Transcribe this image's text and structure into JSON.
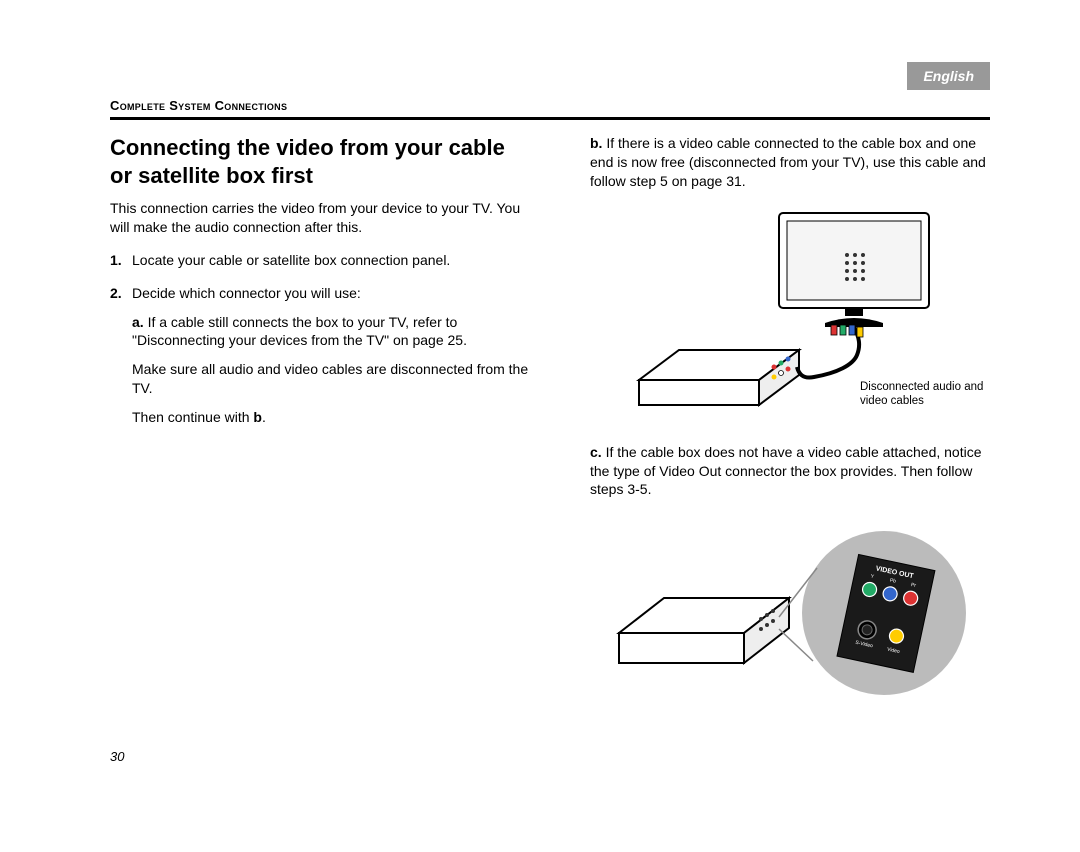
{
  "header": {
    "language_tab": "English",
    "section": "Complete System Connections"
  },
  "left": {
    "title": "Connecting the video from your cable or satellite box first",
    "intro": "This connection carries the video from your device to your TV. You will make the audio connection after this.",
    "steps": [
      {
        "num": "1.",
        "text": "Locate your cable or satellite box connection panel."
      },
      {
        "num": "2.",
        "text": "Decide which connector you will use:",
        "sub_a": {
          "label": "a.",
          "line1": "If a cable still connects the box to your TV, refer to \"Disconnecting your devices from the TV\" on page 25.",
          "line2": "Make sure all audio and video cables are disconnected from the TV.",
          "line3_prefix": "Then continue with ",
          "line3_bold": "b",
          "line3_suffix": "."
        }
      }
    ]
  },
  "right": {
    "sub_b": {
      "label": "b.",
      "text": "If there is a video cable connected to the cable box and one end is now free (disconnected from your TV), use this cable and follow step 5 on page 31."
    },
    "figure1_caption": "Disconnected audio and video cables",
    "sub_c": {
      "label": "c.",
      "text": "If the cable box does not have a video cable attached, notice the type of Video Out connector the box provides. Then follow steps 3-5."
    }
  },
  "page_number": "30"
}
